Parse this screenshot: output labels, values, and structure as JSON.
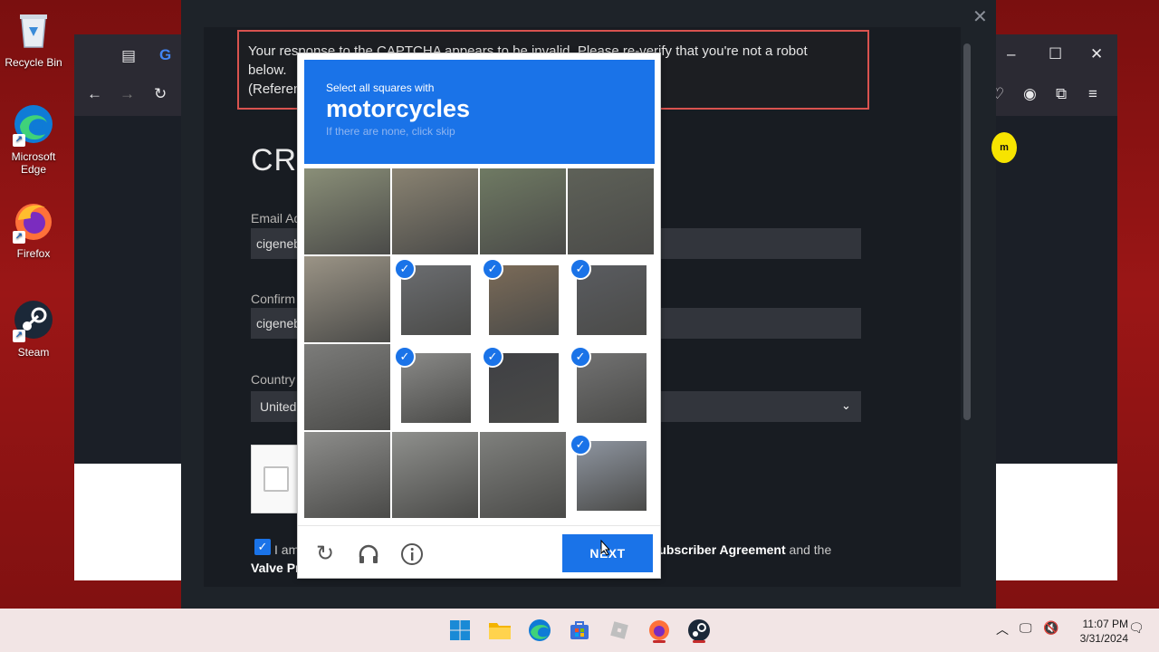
{
  "desktop": {
    "icons": [
      {
        "label": "Recycle Bin",
        "icon": "recycle-bin-icon"
      },
      {
        "label": "Microsoft Edge",
        "icon": "edge-icon"
      },
      {
        "label": "Firefox",
        "icon": "firefox-icon"
      },
      {
        "label": "Steam",
        "icon": "steam-icon"
      }
    ]
  },
  "steam_form": {
    "error_line1": "Your response to the CAPTCHA appears to be invalid. Please re-verify that you're not a robot",
    "error_line2": "below.",
    "error_line3": "(Referen",
    "heading": "CRE",
    "email_label": "Email Ad",
    "email_value": "cigeneb",
    "confirm_label": "Confirm",
    "confirm_value": "cigeneb",
    "country_label": "Country",
    "country_value": "United",
    "agree_prefix": "I am",
    "agree_link1": "Subscriber Agreement",
    "agree_mid": "and the",
    "agree_link2": "Valve Pr",
    "badge_text": "m"
  },
  "captcha": {
    "instruction": "Select all squares with",
    "target": "motorcycles",
    "hint": "If there are none, click skip",
    "next_label": "NEXT",
    "tiles": [
      {
        "selected": false,
        "color": "#8a8f78"
      },
      {
        "selected": false,
        "color": "#8a8372"
      },
      {
        "selected": false,
        "color": "#6f7a63"
      },
      {
        "selected": false,
        "color": "#5e6158"
      },
      {
        "selected": false,
        "color": "#9b9486"
      },
      {
        "selected": true,
        "color": "#6b6d70"
      },
      {
        "selected": true,
        "color": "#7b6b58"
      },
      {
        "selected": true,
        "color": "#5a5c60"
      },
      {
        "selected": false,
        "color": "#7c7c7a"
      },
      {
        "selected": true,
        "color": "#8a8a88"
      },
      {
        "selected": true,
        "color": "#3f4044"
      },
      {
        "selected": true,
        "color": "#727272"
      },
      {
        "selected": false,
        "color": "#8d8d8b"
      },
      {
        "selected": false,
        "color": "#8f908d"
      },
      {
        "selected": false,
        "color": "#7f807d"
      },
      {
        "selected": true,
        "color": "#8e95a0"
      }
    ]
  },
  "taskbar": {
    "time": "11:07 PM",
    "date": "3/31/2024"
  }
}
